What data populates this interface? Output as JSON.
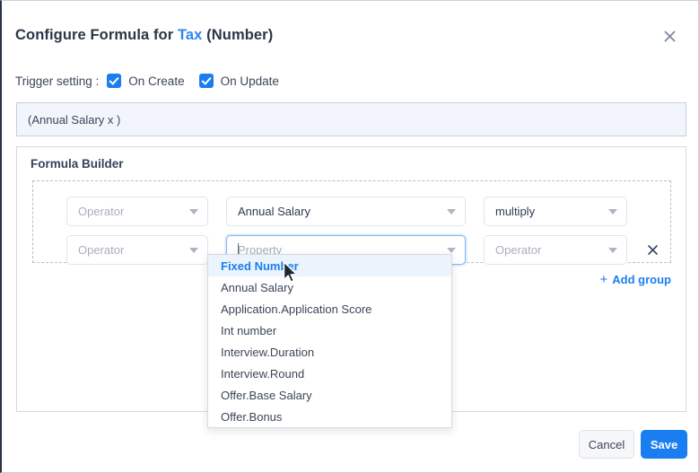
{
  "header": {
    "title_prefix": "Configure Formula for ",
    "title_field": "Tax",
    "title_suffix": " (Number)",
    "close_icon": "close-icon"
  },
  "trigger": {
    "label": "Trigger setting :",
    "options": [
      {
        "label": "On Create",
        "checked": true
      },
      {
        "label": "On Update",
        "checked": true
      }
    ]
  },
  "preview": {
    "expression": "(Annual Salary x )"
  },
  "builder": {
    "title": "Formula Builder",
    "add_group_label": "Add group",
    "add_group_plus": "+",
    "remove_icon": "close-icon",
    "rows": [
      {
        "operator_left": {
          "value": "",
          "placeholder": "Operator"
        },
        "property": {
          "value": "Annual Salary",
          "placeholder": "Property"
        },
        "operator_right": {
          "value": "multiply",
          "placeholder": "Operator"
        }
      },
      {
        "operator_left": {
          "value": "",
          "placeholder": "Operator"
        },
        "property": {
          "value": "",
          "placeholder": "Property"
        },
        "operator_right": {
          "value": "",
          "placeholder": "Operator"
        }
      }
    ]
  },
  "dropdown": {
    "open": true,
    "items": [
      {
        "label": "Fixed Number",
        "selected": true
      },
      {
        "label": "Annual Salary",
        "selected": false
      },
      {
        "label": "Application.Application Score",
        "selected": false
      },
      {
        "label": "Int number",
        "selected": false
      },
      {
        "label": "Interview.Duration",
        "selected": false
      },
      {
        "label": "Interview.Round",
        "selected": false
      },
      {
        "label": "Offer.Base Salary",
        "selected": false
      },
      {
        "label": "Offer.Bonus",
        "selected": false
      }
    ]
  },
  "footer": {
    "cancel_label": "Cancel",
    "save_label": "Save"
  },
  "colors": {
    "accent": "#1a7ef0",
    "link": "#2a86f0",
    "text": "#3b4558",
    "preview_bg": "#f2f6fc"
  }
}
